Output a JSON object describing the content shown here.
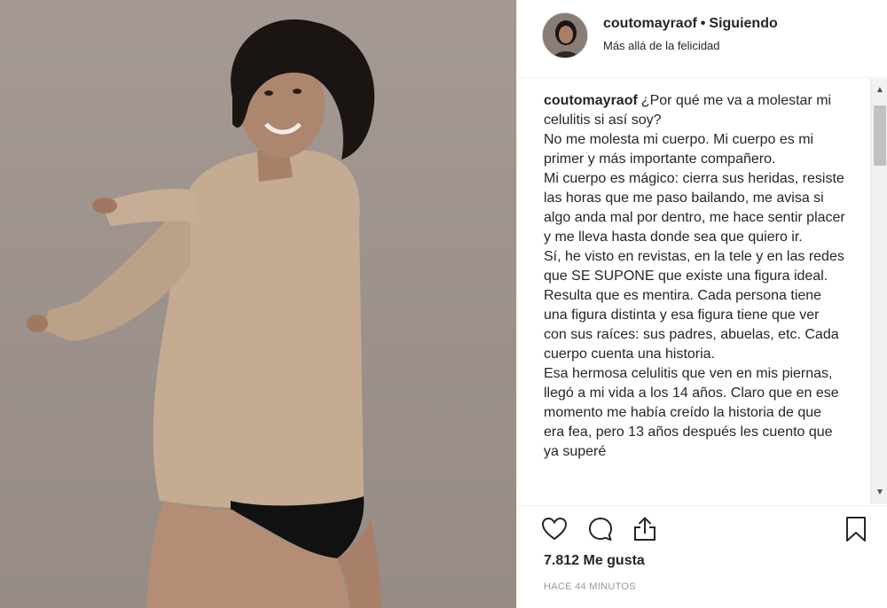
{
  "header": {
    "username": "coutomayraof",
    "separator": "•",
    "follow_label": "Siguiendo",
    "location": "Más allá de la felicidad"
  },
  "caption": {
    "author": "coutomayraof",
    "lines": [
      "¿Por qué me va a molestar mi celulitis si así soy?",
      "No me molesta mi cuerpo. Mi cuerpo es mi primer y más importante compañero.",
      "Mi cuerpo es mágico: cierra sus heridas, resiste las horas que me paso bailando, me avisa si algo anda mal por dentro, me hace sentir placer y me lleva hasta donde sea que quiero ir.",
      "Sí, he visto en revistas, en la tele y en las redes que SE SUPONE que existe una figura ideal. Resulta que es mentira. Cada persona tiene una figura distinta y esa figura tiene que ver con sus raíces: sus padres, abuelas, etc. Cada cuerpo cuenta una historia.",
      "Esa hermosa celulitis que ven en mis piernas, llegó a mi vida a los 14 años. Claro que en ese momento me había creído la historia de que era fea, pero 13 años después les cuento que ya superé"
    ]
  },
  "actions": {
    "like_icon": "heart-icon",
    "comment_icon": "comment-icon",
    "share_icon": "share-icon",
    "save_icon": "bookmark-icon"
  },
  "likes_text": "7.812 Me gusta",
  "time_text": "HACE 44 MINUTOS",
  "scrollbar": {
    "up": "▲",
    "down": "▼"
  },
  "colors": {
    "text": "#262626",
    "muted": "#999999",
    "border": "#efefef",
    "sweater": "#c4ab92"
  }
}
